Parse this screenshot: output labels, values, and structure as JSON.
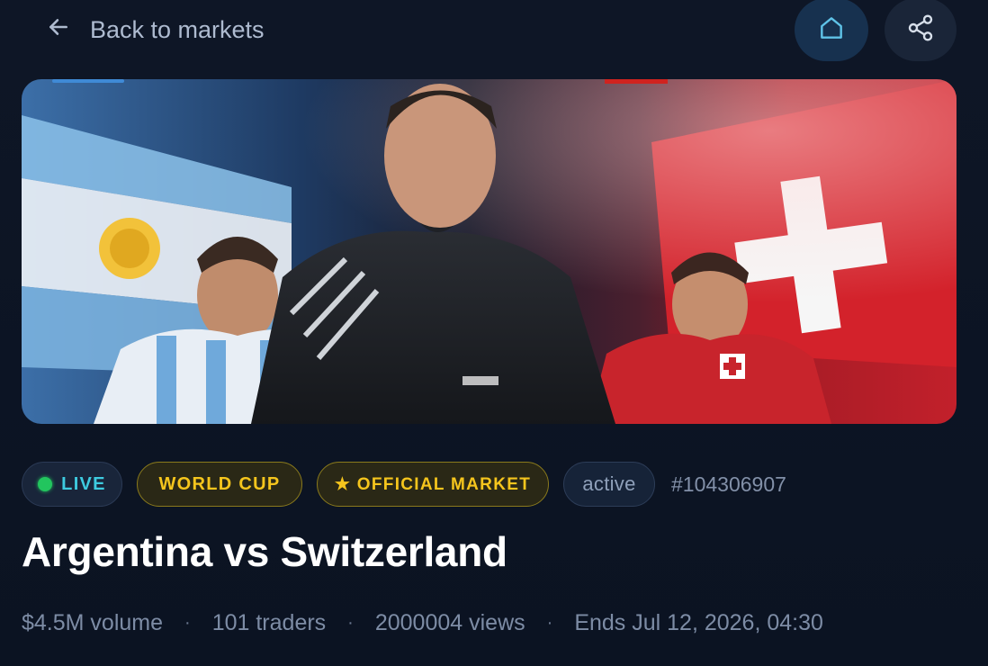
{
  "nav": {
    "back_label": "Back to markets",
    "icons": {
      "back": "arrow-left-icon",
      "home": "home-icon",
      "share": "share-icon"
    }
  },
  "hero": {
    "image_alt": "Argentina vs Switzerland match artwork"
  },
  "badges": {
    "live": "LIVE",
    "category": "WORLD CUP",
    "official": "★ OFFICIAL MARKET",
    "status": "active",
    "market_id": "#104306907"
  },
  "market": {
    "title": "Argentina vs Switzerland"
  },
  "stats": {
    "volume": "$4.5M volume",
    "traders": "101 traders",
    "views": "2000004 views",
    "ends": "Ends Jul 12, 2026, 04:30",
    "separator": "·"
  },
  "colors": {
    "background": "#0d1524",
    "live_text": "#3ecbe0",
    "live_dot": "#22c55e",
    "gold": "#f5c51d",
    "muted": "#7d8ca5"
  }
}
